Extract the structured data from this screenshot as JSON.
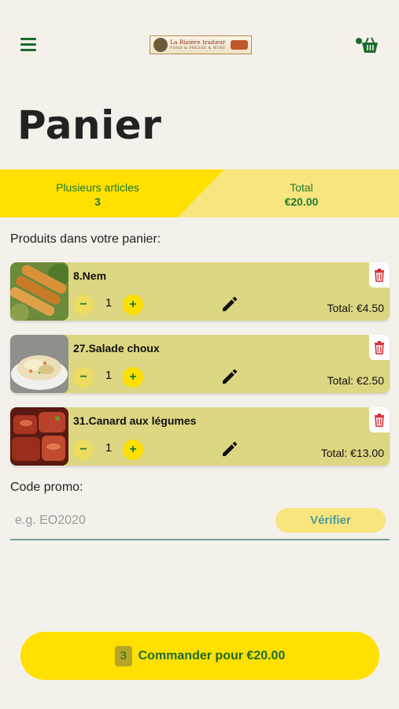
{
  "app": {
    "logo_text": "La Rizière traiteur",
    "logo_subtext": "FOOD & PRESSE & WINE"
  },
  "header": {
    "title": "Panier"
  },
  "summary": {
    "articles_label": "Plusieurs articles",
    "articles_count": "3",
    "total_label": "Total",
    "total_value": "€20.00"
  },
  "cart": {
    "section_label": "Produits dans votre panier:",
    "items": [
      {
        "name": "8.Nem",
        "quantity": "1",
        "minus": "−",
        "plus": "+",
        "total": "Total: €4.50"
      },
      {
        "name": "27.Salade choux",
        "quantity": "1",
        "minus": "−",
        "plus": "+",
        "total": "Total: €2.50"
      },
      {
        "name": "31.Canard aux légumes",
        "quantity": "1",
        "minus": "−",
        "plus": "+",
        "total": "Total: €13.00"
      }
    ]
  },
  "promo": {
    "label": "Code promo:",
    "placeholder": "e.g. EO2020",
    "value": "",
    "verify_label": "Vérifier"
  },
  "order": {
    "count": "3",
    "label": "Commander pour €20.00"
  },
  "colors": {
    "accent_yellow": "#ffe000",
    "light_yellow": "#f9e57e",
    "item_background": "#ddd682",
    "brand_green": "#1f7a2e",
    "delete_red": "#d8262e",
    "background": "#f4f1ea"
  },
  "icons": {
    "menu": "hamburger-menu-icon",
    "cart": "cart-icon",
    "edit": "pencil-icon",
    "delete": "trash-icon"
  }
}
